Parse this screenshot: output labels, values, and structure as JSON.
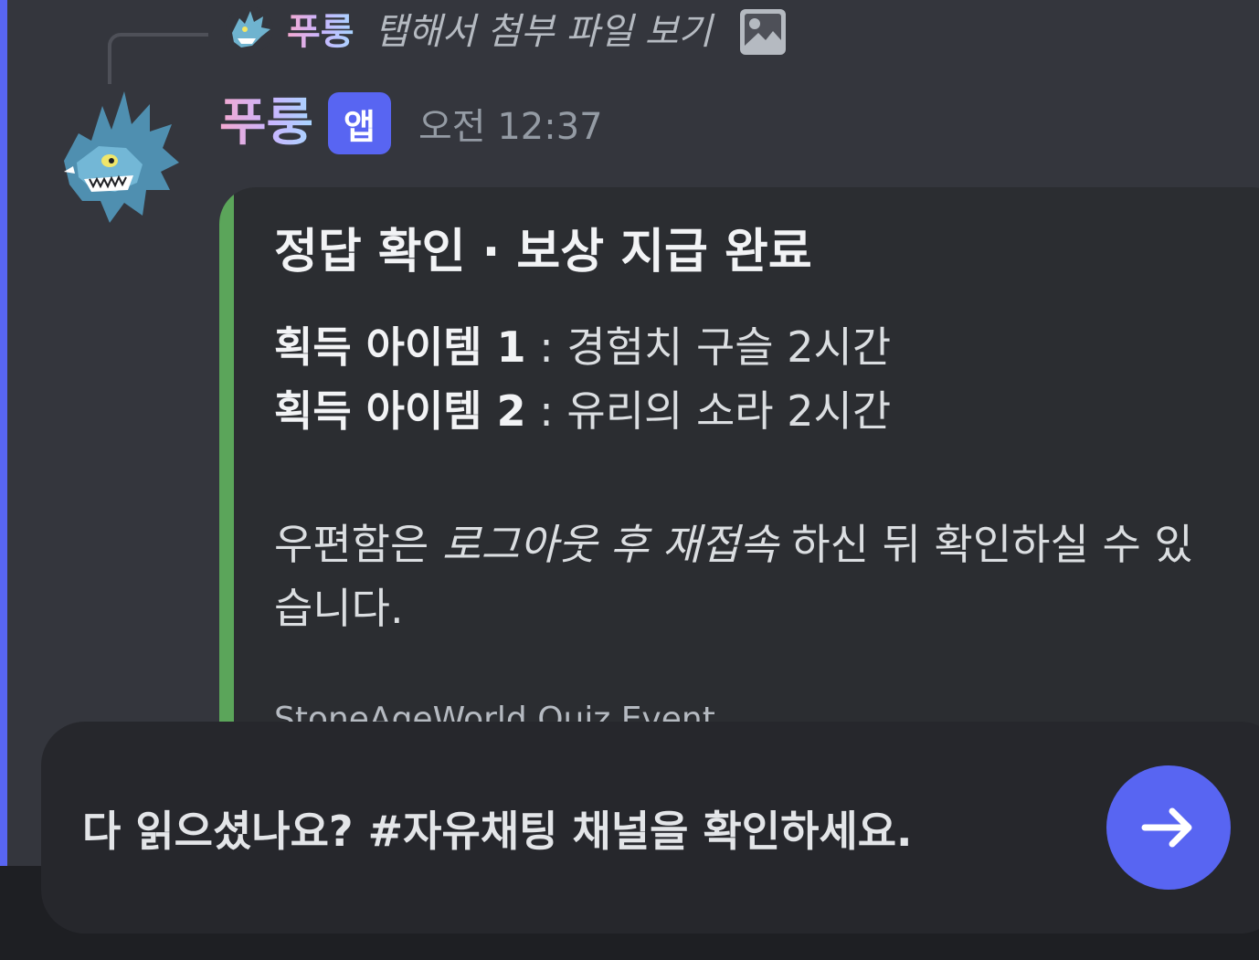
{
  "reply": {
    "author": "푸룽",
    "text": "탭해서 첨부 파일 보기",
    "attachment_icon": "image-icon"
  },
  "message": {
    "author": "푸룽",
    "badge": "앱",
    "timestamp": "오전 12:37"
  },
  "embed": {
    "accent_color": "#5ba55a",
    "title": "정답 확인 · 보상 지급 완료",
    "items": [
      {
        "label": "획득 아이템 1",
        "separator": " : ",
        "value": "경험치 구슬 2시간"
      },
      {
        "label": "획득 아이템 2",
        "separator": " : ",
        "value": "유리의 소라 2시간"
      }
    ],
    "desc_prefix": "우편함은 ",
    "desc_emphasis": "로그아웃 후 재접속",
    "desc_suffix": " 하신 뒤 확인하실 수 있습니다.",
    "footer": "StoneAgeWorld Quiz Event"
  },
  "toast": {
    "text": "다 읽으셨나요? #자유채팅 채널을 확인하세요.",
    "button_icon": "arrow-right-icon",
    "button_color": "#5865f2"
  },
  "colors": {
    "chat_background": "#34363d",
    "embed_background": "#2b2d31",
    "mention_bar": "#5865f2",
    "badge": "#5865f2"
  }
}
